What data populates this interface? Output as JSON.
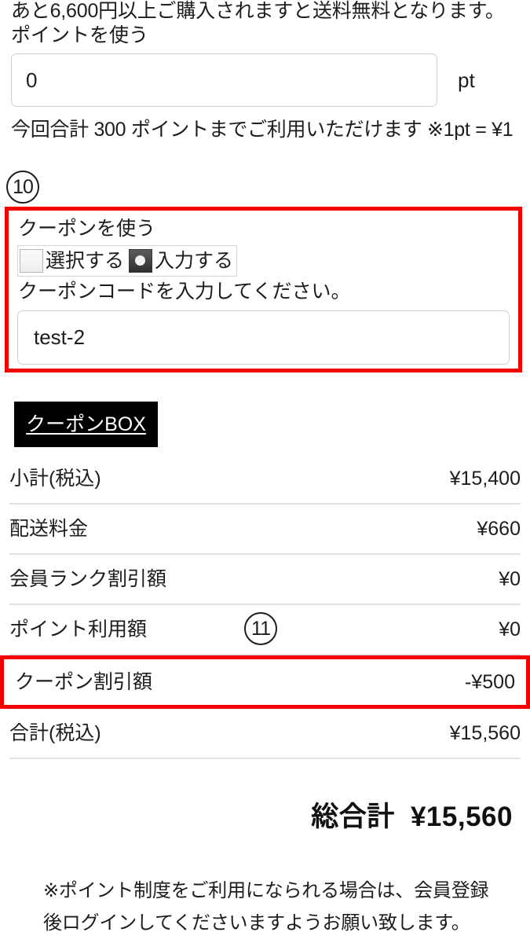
{
  "shipping_note": "あと6,600円以上ご購入されますと送料無料となります。",
  "points": {
    "label": "ポイントを使う",
    "input_value": "0",
    "input_placeholder": "0",
    "unit": "pt",
    "hint": "今回合計 300 ポイントまでご利用いただけます ※1pt = ¥1"
  },
  "markers": {
    "coupon_section": "10",
    "coupon_discount_row": "11"
  },
  "coupon": {
    "title": "クーポンを使う",
    "options": [
      {
        "label": "選択する",
        "selected": false
      },
      {
        "label": "入力する",
        "selected": true
      }
    ],
    "prompt": "クーポンコードを入力してください。",
    "code_value": "test-2",
    "code_placeholder": "クーポンコードを入力してください。",
    "box_button_label": "クーポンBOX"
  },
  "summary": {
    "rows": [
      {
        "label": "小計(税込)",
        "value": "¥15,400",
        "highlighted": false
      },
      {
        "label": "配送料金",
        "value": "¥660",
        "highlighted": false
      },
      {
        "label": "会員ランク割引額",
        "value": "¥0",
        "highlighted": false
      },
      {
        "label": "ポイント利用額",
        "value": "¥0",
        "highlighted": false
      },
      {
        "label": "クーポン割引額",
        "value": "-¥500",
        "highlighted": true
      },
      {
        "label": "合計(税込)",
        "value": "¥15,560",
        "highlighted": false
      }
    ]
  },
  "grand_total": {
    "label": "総合計",
    "amount": "¥15,560"
  },
  "footer_note": {
    "line1": "※ポイント制度をご利用になられる場合は、会員登録",
    "line2": "後ログインしてくださいますようお願い致します。"
  },
  "colors": {
    "highlight_red": "#f50000",
    "button_black": "#000000",
    "rule_gray": "#e3e3e3",
    "text": "#1d1d1d"
  }
}
